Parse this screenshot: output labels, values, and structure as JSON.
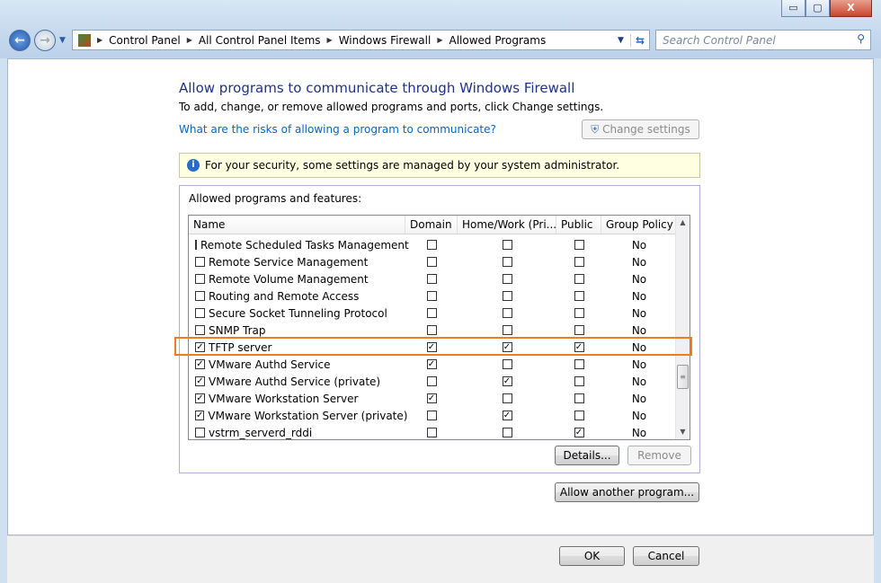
{
  "window": {
    "minimize": "▭",
    "maximize": "▢",
    "close": "X"
  },
  "nav": {
    "back": "←",
    "forward": "→",
    "breadcrumb": [
      "Control Panel",
      "All Control Panel Items",
      "Windows Firewall",
      "Allowed Programs"
    ],
    "search_placeholder": "Search Control Panel"
  },
  "page": {
    "title": "Allow programs to communicate through Windows Firewall",
    "subtitle": "To add, change, or remove allowed programs and ports, click Change settings.",
    "risk_link": "What are the risks of allowing a program to communicate?",
    "change_settings": "Change settings",
    "info": "For your security, some settings are managed by your system administrator.",
    "group_label": "Allowed programs and features:"
  },
  "table": {
    "columns": [
      "Name",
      "Domain",
      "Home/Work (Pri...",
      "Public",
      "Group Policy"
    ],
    "rows": [
      {
        "name": "Remote Scheduled Tasks Management",
        "enabled": false,
        "domain": false,
        "home": false,
        "public": false,
        "gp": "No"
      },
      {
        "name": "Remote Service Management",
        "enabled": false,
        "domain": false,
        "home": false,
        "public": false,
        "gp": "No"
      },
      {
        "name": "Remote Volume Management",
        "enabled": false,
        "domain": false,
        "home": false,
        "public": false,
        "gp": "No"
      },
      {
        "name": "Routing and Remote Access",
        "enabled": false,
        "domain": false,
        "home": false,
        "public": false,
        "gp": "No"
      },
      {
        "name": "Secure Socket Tunneling Protocol",
        "enabled": false,
        "domain": false,
        "home": false,
        "public": false,
        "gp": "No"
      },
      {
        "name": "SNMP Trap",
        "enabled": false,
        "domain": false,
        "home": false,
        "public": false,
        "gp": "No"
      },
      {
        "name": "TFTP server",
        "enabled": true,
        "domain": true,
        "home": true,
        "public": true,
        "gp": "No",
        "highlighted": true
      },
      {
        "name": "VMware Authd Service",
        "enabled": true,
        "domain": true,
        "home": false,
        "public": false,
        "gp": "No"
      },
      {
        "name": "VMware Authd Service (private)",
        "enabled": true,
        "domain": false,
        "home": true,
        "public": false,
        "gp": "No"
      },
      {
        "name": "VMware Workstation Server",
        "enabled": true,
        "domain": true,
        "home": false,
        "public": false,
        "gp": "No"
      },
      {
        "name": "VMware Workstation Server (private)",
        "enabled": true,
        "domain": false,
        "home": true,
        "public": false,
        "gp": "No"
      },
      {
        "name": "vstrm_serverd_rddi",
        "enabled": false,
        "domain": false,
        "home": false,
        "public": true,
        "gp": "No"
      }
    ]
  },
  "buttons": {
    "details": "Details...",
    "remove": "Remove",
    "allow_another": "Allow another program...",
    "ok": "OK",
    "cancel": "Cancel"
  },
  "colors": {
    "highlight": "#f07c22",
    "title": "#1e3287",
    "link": "#0066cc",
    "info_bg": "#ffffe1"
  }
}
